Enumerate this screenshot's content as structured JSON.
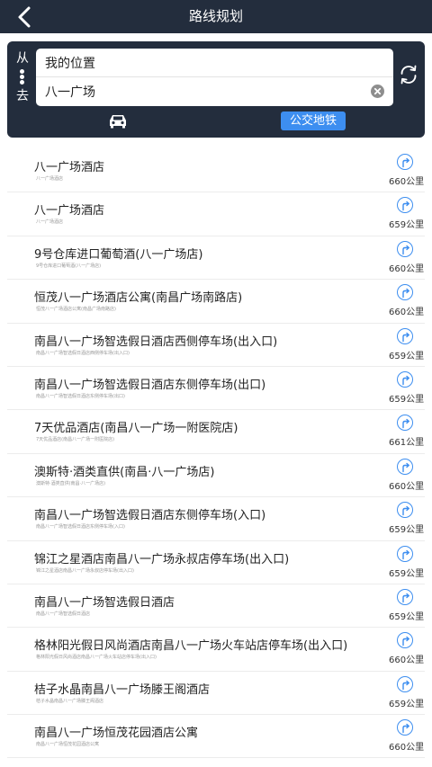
{
  "header": {
    "title": "路线规划"
  },
  "route": {
    "from_label": "从",
    "to_label": "去",
    "from_value": "我的位置",
    "to_value": "八一广场"
  },
  "modes": {
    "transit_label": "公交地铁"
  },
  "colors": {
    "header_bg": "#232d3d",
    "accent": "#3d8ef0"
  },
  "results": [
    {
      "name": "八一广场酒店",
      "sub": "八一广场酒店",
      "dist": "660公里"
    },
    {
      "name": "八一广场酒店",
      "sub": "八一广场酒店",
      "dist": "659公里"
    },
    {
      "name": "9号仓库进口葡萄酒(八一广场店)",
      "sub": "9号仓库进口葡萄酒(八一广场店)",
      "dist": "660公里"
    },
    {
      "name": "恒茂八一广场酒店公寓(南昌广场南路店)",
      "sub": "恒茂八一广场酒店公寓(南昌广场南路店)",
      "dist": "660公里"
    },
    {
      "name": "南昌八一广场智选假日酒店西侧停车场(出入口)",
      "sub": "南昌八一广场智选假日酒店西侧停车场(出入口)",
      "dist": "659公里"
    },
    {
      "name": "南昌八一广场智选假日酒店东侧停车场(出口)",
      "sub": "南昌八一广场智选假日酒店东侧停车场(出口)",
      "dist": "659公里"
    },
    {
      "name": "7天优品酒店(南昌八一广场一附医院店)",
      "sub": "7天优品酒店(南昌八一广场一附医院店)",
      "dist": "661公里"
    },
    {
      "name": "澳斯特·酒类直供(南昌·八一广场店)",
      "sub": "澳斯特·酒类直供(南昌·八一广场店)",
      "dist": "660公里"
    },
    {
      "name": "南昌八一广场智选假日酒店东侧停车场(入口)",
      "sub": "南昌八一广场智选假日酒店东侧停车场(入口)",
      "dist": "659公里"
    },
    {
      "name": "锦江之星酒店南昌八一广场永叔店停车场(出入口)",
      "sub": "锦江之星酒店南昌八一广场永叔店停车场(出入口)",
      "dist": "659公里"
    },
    {
      "name": "南昌八一广场智选假日酒店",
      "sub": "南昌八一广场智选假日酒店",
      "dist": "659公里"
    },
    {
      "name": "格林阳光假日风尚酒店南昌八一广场火车站店停车场(出入口)",
      "sub": "格林阳光假日风尚酒店南昌八一广场火车站店停车场(出入口)",
      "dist": "660公里"
    },
    {
      "name": "桔子水晶南昌八一广场滕王阁酒店",
      "sub": "桔子水晶南昌八一广场滕王阁酒店",
      "dist": "659公里"
    },
    {
      "name": "南昌八一广场恒茂花园酒店公寓",
      "sub": "南昌八一广场恒茂花园酒店公寓",
      "dist": "660公里"
    }
  ]
}
